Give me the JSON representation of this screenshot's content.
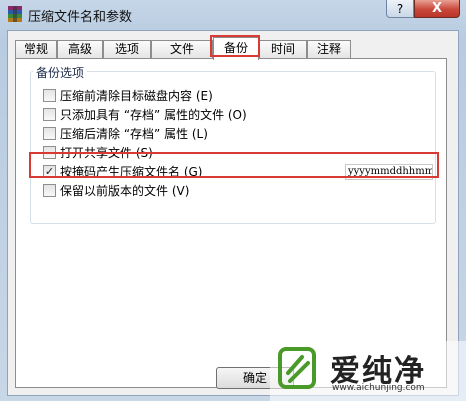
{
  "window": {
    "title": "压缩文件名和参数",
    "help_label": "?",
    "close_label": "X"
  },
  "tabs": [
    {
      "label": "常规",
      "active": false
    },
    {
      "label": "高级",
      "active": false
    },
    {
      "label": "选项",
      "active": false
    },
    {
      "label": "文件",
      "active": false
    },
    {
      "label": "备份",
      "active": true
    },
    {
      "label": "时间",
      "active": false
    },
    {
      "label": "注释",
      "active": false
    }
  ],
  "backup_group": {
    "label": "备份选项",
    "options": [
      {
        "label": "压缩前清除目标磁盘内容 (E)",
        "checked": false
      },
      {
        "label": "只添加具有 “存档” 属性的文件 (O)",
        "checked": false
      },
      {
        "label": "压缩后清除 “存档” 属性 (L)",
        "checked": false
      },
      {
        "label": "打开共享文件 (S)",
        "checked": false
      },
      {
        "label": "按掩码产生压缩文件名 (G)",
        "checked": true
      },
      {
        "label": "保留以前版本的文件 (V)",
        "checked": false
      }
    ],
    "name_mask_value": "yyyymmddhhmmss"
  },
  "buttons": {
    "ok_label": "确定"
  },
  "watermark": {
    "text": "爱纯净",
    "url": "www.aichunjing.com"
  },
  "colors": {
    "highlight": "#d83b34",
    "close_button": "#c9483a",
    "watermark_logo": "#4a9a2a"
  }
}
